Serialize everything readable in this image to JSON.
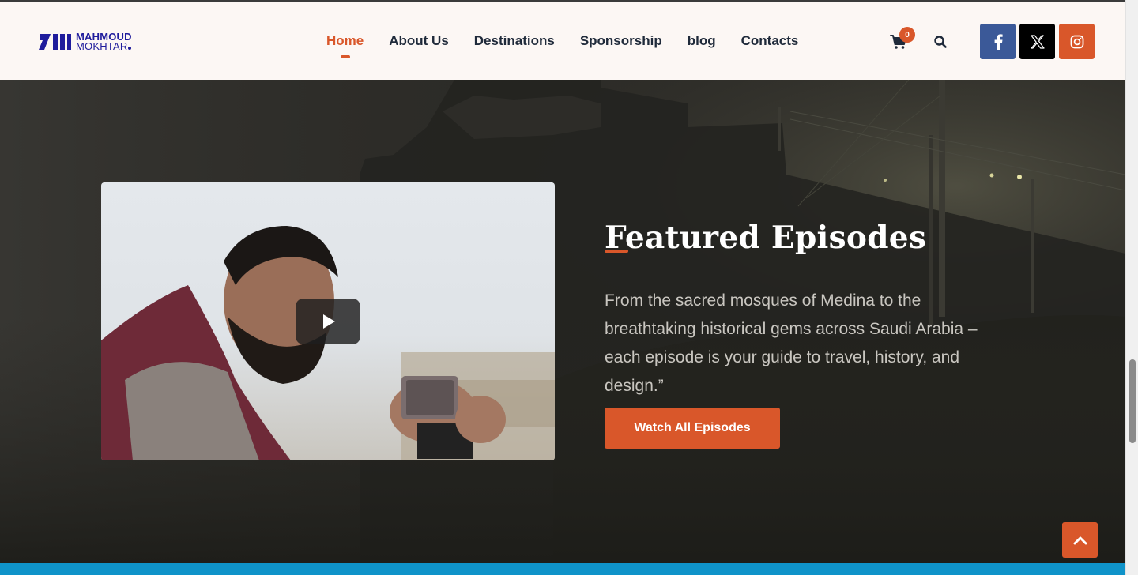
{
  "brand": {
    "line1": "MAHMOUD",
    "line2": "MOKHTAR"
  },
  "nav": {
    "items": [
      {
        "label": "Home",
        "active": true
      },
      {
        "label": "About Us",
        "active": false
      },
      {
        "label": "Destinations",
        "active": false
      },
      {
        "label": "Sponsorship",
        "active": false
      },
      {
        "label": "blog",
        "active": false
      },
      {
        "label": "Contacts",
        "active": false
      }
    ]
  },
  "header": {
    "cart_count": "0",
    "cart_icon": "cart-icon",
    "search_icon": "search-icon"
  },
  "social": [
    {
      "name": "facebook",
      "icon": "facebook-icon",
      "color": "#3b5998"
    },
    {
      "name": "x",
      "icon": "x-icon",
      "color": "#000000"
    },
    {
      "name": "instagram",
      "icon": "instagram-icon",
      "color": "#d9572a"
    }
  ],
  "featured": {
    "title": "Featured Episodes",
    "description": "From the sacred mosques of Medina to the breathtaking historical gems across Saudi Arabia – each episode is your guide to travel, history, and design.”",
    "button_label": "Watch All Episodes"
  },
  "video": {
    "play_icon": "play-icon"
  },
  "colors": {
    "accent": "#d9572a",
    "brand_blue": "#1f1c9c",
    "nav_text": "#1f2a3a",
    "header_bg": "#fcf7f4",
    "hero_bg": "#2a2925",
    "next_section": "#0f93c9"
  }
}
